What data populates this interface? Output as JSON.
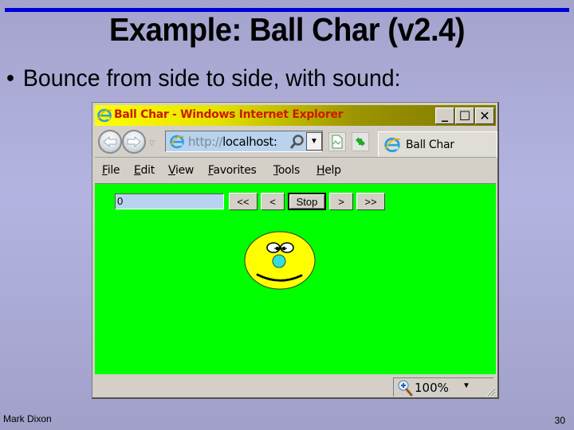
{
  "slide": {
    "title": "Example: Ball Char (v2.4)",
    "bullet_marker": "•",
    "bullet_text": "Bounce from side to side, with sound:",
    "footer_author": "Mark Dixon",
    "page_number": "30",
    "rule_color": "#0000dd",
    "background_color": "#b4b4e2"
  },
  "browser": {
    "window_title": "Ball Char - Windows Internet Explorer",
    "window_controls": {
      "minimize": "_",
      "maximize": "☐",
      "close": "✕"
    },
    "address": {
      "scheme": "http://",
      "host": "localhost:"
    },
    "tab_label": "Ball Char",
    "menu": [
      {
        "accel": "F",
        "rest": "ile",
        "label": "File"
      },
      {
        "accel": "E",
        "rest": "dit",
        "label": "Edit"
      },
      {
        "accel": "V",
        "rest": "iew",
        "label": "View"
      },
      {
        "accel": "F",
        "rest": "avorites",
        "label": "Favorites"
      },
      {
        "accel": "T",
        "rest": "ools",
        "label": "Tools"
      },
      {
        "accel": "H",
        "rest": "elp",
        "label": "Help"
      }
    ],
    "status": {
      "zoom_level": "100%"
    }
  },
  "page": {
    "background_color": "#00ff00",
    "position_input_value": "0",
    "buttons": {
      "fast_left": "<<",
      "left": "<",
      "stop": "Stop",
      "right": ">",
      "fast_right": ">>"
    },
    "ball_character": {
      "face_color": "#ffff00",
      "nose_color": "#33dddd"
    }
  }
}
